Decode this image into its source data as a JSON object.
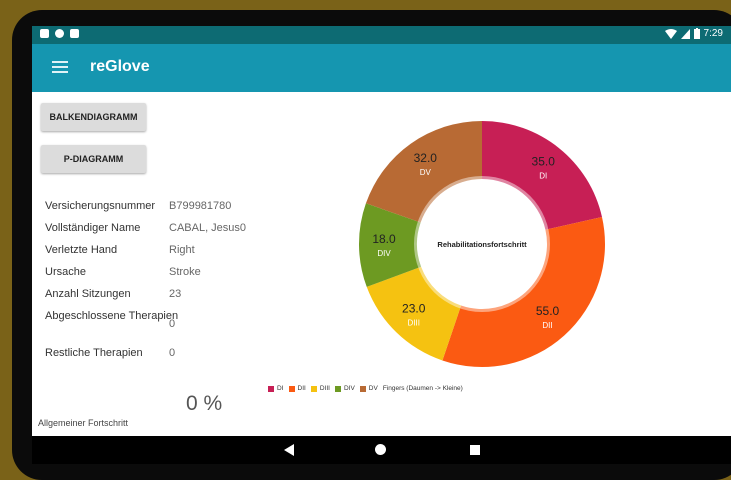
{
  "status_bar": {
    "time": "7:29",
    "icons": [
      "notification-a-icon",
      "notification-circle-icon",
      "sd-card-icon",
      "wifi-icon",
      "signal-icon",
      "battery-icon"
    ]
  },
  "app_bar": {
    "title": "reGlove",
    "menu_icon": "hamburger-menu-icon"
  },
  "buttons": {
    "bar_chart": "BALKENDIAGRAMM",
    "p_chart": "P-DIAGRAMM"
  },
  "patient": [
    {
      "label": "Versicherungsnummer",
      "value": "B799981780"
    },
    {
      "label": "Vollständiger Name",
      "value": "CABAL, Jesus0"
    },
    {
      "label": "Verletzte Hand",
      "value": "Right"
    },
    {
      "label": "Ursache",
      "value": "Stroke"
    },
    {
      "label": "Anzahl Sitzungen",
      "value": "23"
    },
    {
      "label": "Abgeschlossene Therapien",
      "value": "0"
    },
    {
      "label": "Restliche Therapien",
      "value": "0"
    }
  ],
  "progress": {
    "percent_text": "0 %",
    "label": "Allgemeiner Fortschritt"
  },
  "chart_data": {
    "type": "pie",
    "center_text": "Rehabilitationsfortschritt",
    "categories": [
      "DI",
      "DII",
      "DIII",
      "DIV",
      "DV"
    ],
    "values": [
      35.0,
      55.0,
      23.0,
      18.0,
      32.0
    ],
    "value_labels": [
      "35.0",
      "55.0",
      "23.0",
      "18.0",
      "32.0"
    ],
    "colors": [
      "#c71f55",
      "#fb5a12",
      "#f5c211",
      "#6d9a22",
      "#b86a34"
    ],
    "legend_suffix": "Fingers (Daumen -> Kleine)",
    "legend_position": "bottom"
  }
}
